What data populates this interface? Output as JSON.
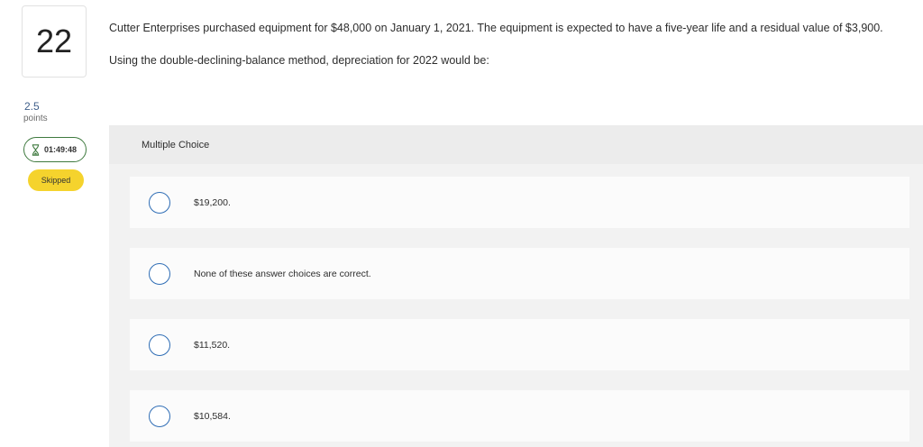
{
  "question": {
    "number": "22",
    "points_value": "2.5",
    "points_label": "points",
    "timer": "01:49:48",
    "status_badge": "Skipped",
    "text_1": "Cutter Enterprises purchased equipment for $48,000 on January 1, 2021. The equipment is expected to have a five-year life and a residual value of $3,900.",
    "text_2": "Using the double-declining-balance method, depreciation for 2022 would be:"
  },
  "choices": {
    "header": "Multiple Choice",
    "options": [
      {
        "label": "$19,200."
      },
      {
        "label": "None of these answer choices are correct."
      },
      {
        "label": "$11,520."
      },
      {
        "label": "$10,584."
      }
    ]
  },
  "colors": {
    "radio_border": "#2f6db5",
    "badge_skipped": "#f5d32d",
    "timer_border": "#3f7a3f"
  },
  "icons": {
    "timer": "hourglass-icon"
  }
}
